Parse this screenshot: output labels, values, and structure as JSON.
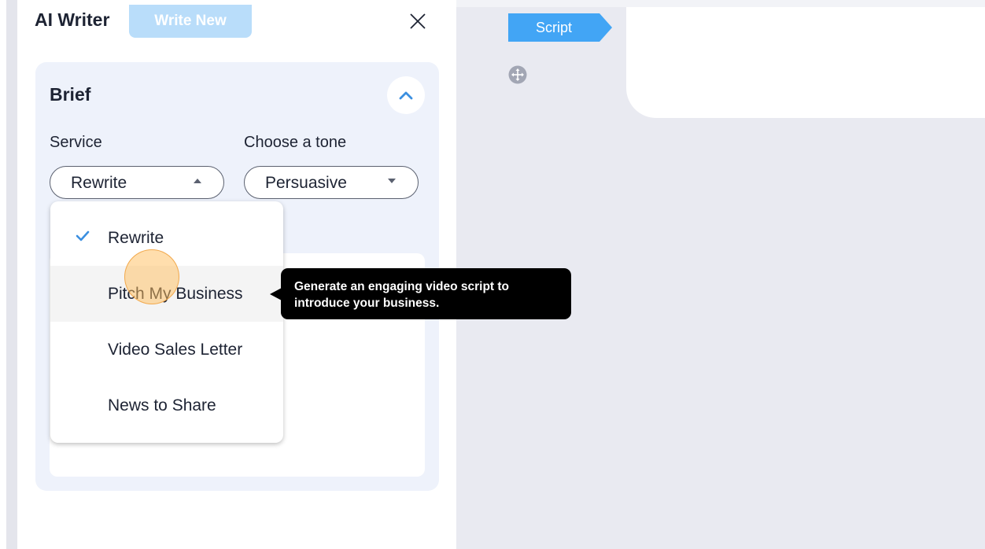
{
  "header": {
    "title": "AI Writer",
    "write_new_label": "Write New"
  },
  "brief": {
    "title": "Brief",
    "service_label": "Service",
    "service_value": "Rewrite",
    "tone_label": "Choose a tone",
    "tone_value": "Persuasive"
  },
  "service_menu": {
    "items": [
      {
        "label": "Rewrite",
        "selected": true
      },
      {
        "label": "Pitch My Business",
        "hovered": true
      },
      {
        "label": "Video Sales Letter"
      },
      {
        "label": "News to Share"
      }
    ]
  },
  "tooltip": {
    "text": "Generate an engaging video script to introduce your business."
  },
  "canvas": {
    "script_tag_label": "Script"
  },
  "colors": {
    "accent_blue": "#42a5f5",
    "write_new_bg": "#b9ddfa",
    "brief_bg": "#eef2fb",
    "canvas_bg": "#e9eaf1"
  },
  "icons": {
    "close": "close-icon",
    "collapse": "chevron-up-icon",
    "check": "check-icon",
    "move": "move-icon"
  }
}
